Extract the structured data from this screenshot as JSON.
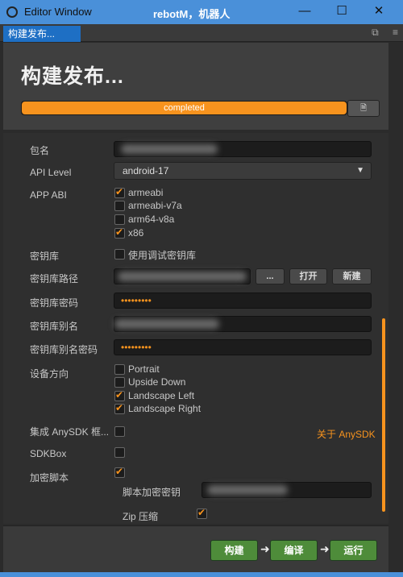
{
  "window": {
    "title": "Editor Window",
    "center_title": "rebotM，机器人",
    "minimize": "—",
    "maximize": "☐",
    "close": "✕"
  },
  "tab": {
    "label": "构建发布...",
    "tools": [
      "⧉",
      "≡"
    ]
  },
  "header": {
    "title": "构建发布...",
    "progress": 1.0,
    "progress_label": "completed",
    "log_icon": "document-icon"
  },
  "form": {
    "package_label": "包名",
    "api_level_label": "API Level",
    "api_level_value": "android-17",
    "app_abi_label": "APP ABI",
    "abi_options": [
      {
        "label": "armeabi",
        "checked": true
      },
      {
        "label": "armeabi-v7a",
        "checked": false
      },
      {
        "label": "arm64-v8a",
        "checked": false
      },
      {
        "label": "x86",
        "checked": true
      }
    ],
    "keystore_label": "密钥库",
    "debug_keystore_label": "使用调试密钥库",
    "keystore_path_label": "密钥库路径",
    "browse_label": "...",
    "open_label": "打开",
    "new_label": "新建",
    "keystore_password_label": "密钥库密码",
    "keystore_password_value": "•••••••••",
    "alias_label": "密钥库别名",
    "alias_password_label": "密钥库别名密码",
    "alias_password_value": "•••••••••",
    "orientation_label": "设备方向",
    "orientation_options": [
      {
        "label": "Portrait",
        "checked": false
      },
      {
        "label": "Upside Down",
        "checked": false
      },
      {
        "label": "Landscape Left",
        "checked": true
      },
      {
        "label": "Landscape Right",
        "checked": true
      }
    ],
    "anysdk_label": "集成 AnySDK 框...",
    "anysdk_link": "关于 AnySDK",
    "sdkbox_label": "SDKBox",
    "encrypt_label": "加密脚本",
    "encrypt_key_label": "脚本加密密钥",
    "zip_label": "Zip 压缩"
  },
  "footer": {
    "build_label": "构建",
    "compile_label": "编译",
    "run_label": "运行"
  },
  "colors": {
    "accent": "#f7931e",
    "action": "#4e8c3a",
    "titlebar": "#4a90d9"
  }
}
